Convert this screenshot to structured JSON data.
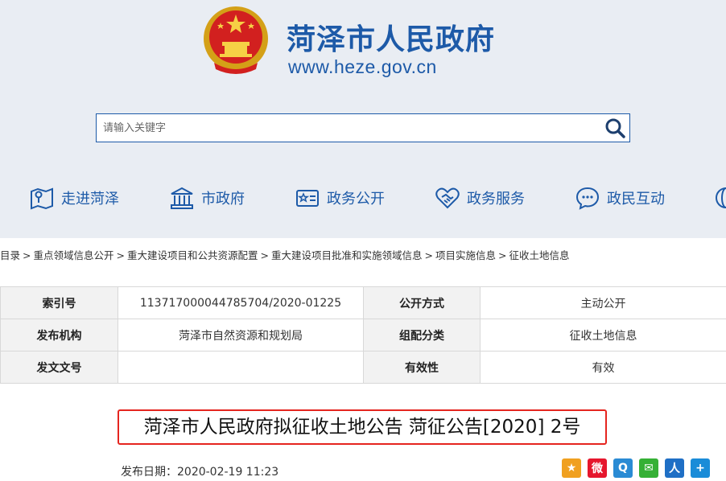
{
  "header": {
    "site_title": "菏泽市人民政府",
    "site_url": "www.heze.gov.cn",
    "emblem_icon": "national-emblem-icon"
  },
  "search": {
    "placeholder": "请输入关键字",
    "icon": "search-icon"
  },
  "nav": {
    "items": [
      {
        "label": "走进菏泽",
        "icon": "map-icon"
      },
      {
        "label": "市政府",
        "icon": "government-building-icon"
      },
      {
        "label": "政务公开",
        "icon": "id-card-icon"
      },
      {
        "label": "政务服务",
        "icon": "handshake-icon"
      },
      {
        "label": "政民互动",
        "icon": "chat-icon"
      }
    ]
  },
  "breadcrumb": {
    "items": [
      "目录",
      "重点领域信息公开",
      "重大建设项目和公共资源配置",
      "重大建设项目批准和实施领域信息",
      "项目实施信息",
      "征收土地信息"
    ],
    "separator": ">"
  },
  "meta": {
    "rows": [
      [
        {
          "k": "索引号",
          "v": "113717000044785704/2020-01225"
        },
        {
          "k": "公开方式",
          "v": "主动公开"
        }
      ],
      [
        {
          "k": "发布机构",
          "v": "菏泽市自然资源和规划局"
        },
        {
          "k": "组配分类",
          "v": "征收土地信息"
        }
      ],
      [
        {
          "k": "发文文号",
          "v": ""
        },
        {
          "k": "有效性",
          "v": "有效"
        }
      ]
    ]
  },
  "document": {
    "title": "菏泽市人民政府拟征收土地公告 菏征公告[2020] 2号",
    "date_label": "发布日期：",
    "date": "2020-02-19 11:23"
  },
  "share": {
    "items": [
      {
        "icon": "qzone-star-icon",
        "glyph": "★",
        "color": "#f0a020"
      },
      {
        "icon": "weibo-icon",
        "glyph": "微",
        "color": "#e6162d"
      },
      {
        "icon": "tencent-weibo-icon",
        "glyph": "Q",
        "color": "#2a8bd4"
      },
      {
        "icon": "wechat-icon",
        "glyph": "✉",
        "color": "#35b035"
      },
      {
        "icon": "renren-icon",
        "glyph": "人",
        "color": "#1f6fc5"
      },
      {
        "icon": "more-share-icon",
        "glyph": "+",
        "color": "#1a8cd8"
      }
    ]
  },
  "colors": {
    "brand_blue": "#1d5aa8",
    "highlight_red": "#e5251f",
    "header_bg": "#e9edf3"
  }
}
